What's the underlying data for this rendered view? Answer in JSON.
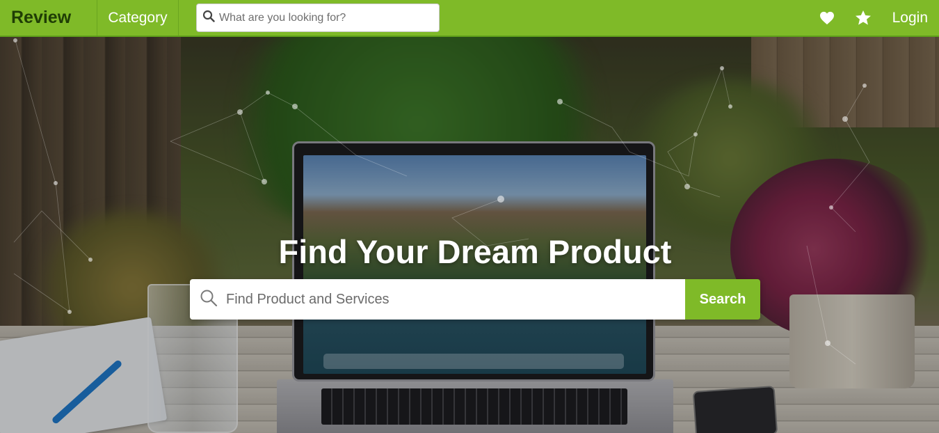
{
  "navbar": {
    "brand": "Review",
    "category_label": "Category",
    "search": {
      "placeholder": "What are you looking for?",
      "value": ""
    },
    "icons": {
      "favorites": "heart-icon",
      "rated": "star-icon",
      "search": "search-icon"
    },
    "login_label": "Login"
  },
  "hero": {
    "title": "Find Your Dream Product",
    "search": {
      "placeholder": "Find Product and Services",
      "value": ""
    },
    "search_button_label": "Search",
    "background_description_icons": {
      "search": "search-icon"
    }
  },
  "colors": {
    "brand_green": "#7fba28",
    "brand_dark": "#1f3d05",
    "white": "#ffffff"
  }
}
